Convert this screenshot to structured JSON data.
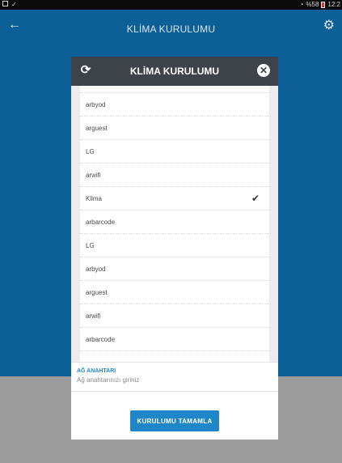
{
  "status_bar": {
    "battery_text": "%58",
    "time": "12:2"
  },
  "app_bar": {
    "title": "KLİMA KURULUMU",
    "back_icon": "arrow-left-icon",
    "settings_icon": "gear-icon"
  },
  "dialog": {
    "title": "KLİMA KURULUMU",
    "refresh_icon": "refresh-icon",
    "close_icon": "close-icon",
    "networks": [
      {
        "name": "LG",
        "selected": false
      },
      {
        "name": "arbyod",
        "selected": false
      },
      {
        "name": "arguest",
        "selected": false
      },
      {
        "name": "LG",
        "selected": false
      },
      {
        "name": "arwifi",
        "selected": false
      },
      {
        "name": "Klima",
        "selected": true
      },
      {
        "name": "arbarcode",
        "selected": false
      },
      {
        "name": "LG",
        "selected": false
      },
      {
        "name": "arbyod",
        "selected": false
      },
      {
        "name": "arguest",
        "selected": false
      },
      {
        "name": "arwifi",
        "selected": false
      },
      {
        "name": "arbarcode",
        "selected": false
      }
    ],
    "key_label": "AĞ ANAHTARI",
    "key_placeholder": "Ağ anahtarınızı giriniz",
    "complete_button": "KURULUMU TAMAMLA"
  }
}
